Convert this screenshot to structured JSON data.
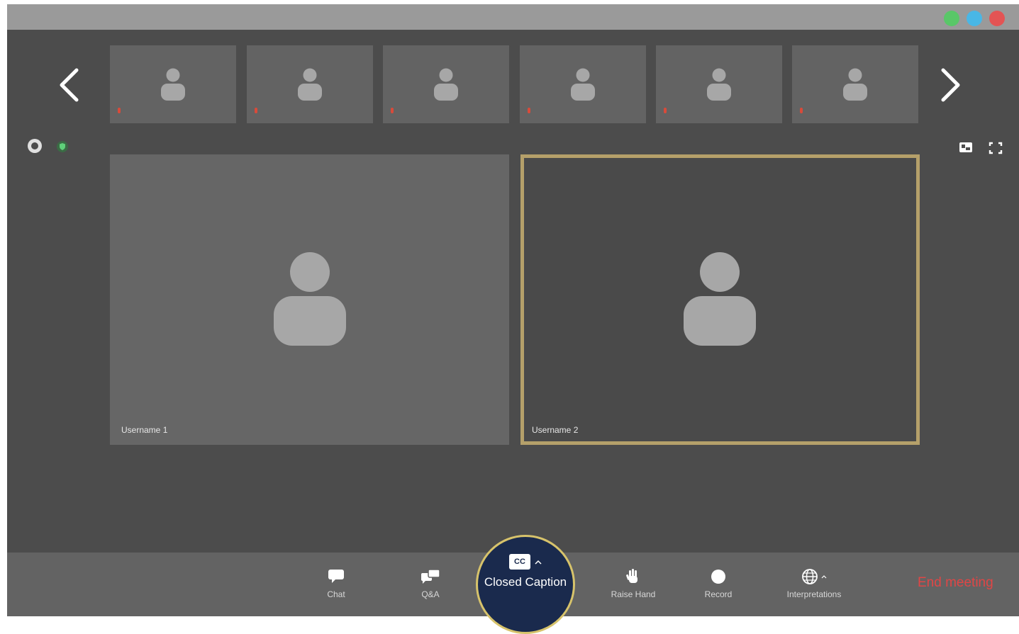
{
  "colors": {
    "titlebar": "#9a9a9a",
    "background": "#4c4c4c",
    "tile_bg": "#636363",
    "active_tile_bg": "#4a4a4a",
    "active_border": "#b5a06a",
    "avatar": "#a7a7a7",
    "cc_circle": "#1a2a4d",
    "cc_ring": "#d7c36b",
    "end_meeting": "#e04646",
    "mic_muted": "#d94a3a"
  },
  "window_controls": {
    "dots": [
      {
        "name": "maximize",
        "color": "#59c768"
      },
      {
        "name": "minimize",
        "color": "#49b7e6"
      },
      {
        "name": "close",
        "color": "#e35454"
      }
    ]
  },
  "icons": {
    "prev": "chevron-left-icon",
    "next": "chevron-right-icon",
    "info": "info-circle-icon",
    "security": "shield-icon",
    "view": "speaker-view-icon",
    "fullscreen": "fullscreen-icon",
    "avatar": "person-icon",
    "mic_muted": "mic-muted-icon"
  },
  "thumbnails": [
    {
      "id": 1
    },
    {
      "id": 2
    },
    {
      "id": 3
    },
    {
      "id": 4
    },
    {
      "id": 5
    },
    {
      "id": 6
    }
  ],
  "tiles": [
    {
      "username": "Username 1"
    },
    {
      "username": "Username 2"
    }
  ],
  "toolbar": {
    "chat": "Chat",
    "qa": "Q&A",
    "closed_caption": "Closed Caption",
    "cc_badge": "CC",
    "raise_hand": "Raise Hand",
    "record": "Record",
    "interpretations": "Interpretations",
    "end_meeting": "End meeting"
  }
}
